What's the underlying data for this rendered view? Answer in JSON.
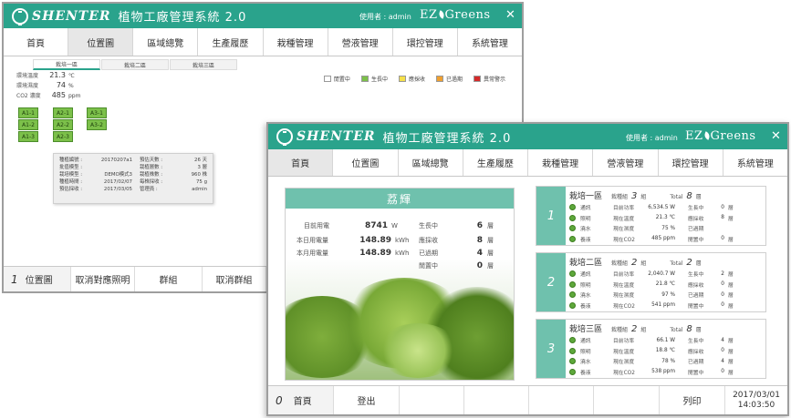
{
  "w1": {
    "brand": "SHENTER",
    "app_title": "植物工廠管理系統 2.0",
    "user": "使用者 : admin",
    "ez_left": "EZ",
    "ez_right": "Greens",
    "nav": [
      "首頁",
      "位置圖",
      "區域總覽",
      "生產履歷",
      "栽種管理",
      "營液管理",
      "環控管理",
      "系統管理"
    ],
    "subtabs": [
      "栽培一區",
      "栽培二區",
      "栽培三區"
    ],
    "env": [
      {
        "label": "環境溫度",
        "value": "21.3",
        "unit": "℃"
      },
      {
        "label": "環境濕度",
        "value": "74",
        "unit": "%"
      },
      {
        "label": "CO2 濃度",
        "value": "485",
        "unit": "ppm"
      }
    ],
    "legend": [
      {
        "label": "閒置中",
        "color": "#ffffff"
      },
      {
        "label": "生長中",
        "color": "#7cc04a"
      },
      {
        "label": "應採收",
        "color": "#f5e04a"
      },
      {
        "label": "已過期",
        "color": "#f0a030"
      },
      {
        "label": "異常警示",
        "color": "#d42a2a"
      }
    ],
    "plots": [
      "A1-1",
      "A1-2",
      "A1-3",
      "A2-1",
      "A2-2",
      "A2-3",
      "A3-1",
      "A3-2"
    ],
    "info_left": [
      {
        "k": "種植編號 :",
        "v": "20170207a1"
      },
      {
        "k": "批值模型 :",
        "v": ""
      },
      {
        "k": "栽培模型 :",
        "v": "DEMO模式3"
      },
      {
        "k": "種植時間 :",
        "v": "2017/02/07"
      },
      {
        "k": "預估採收 :",
        "v": "2017/03/05"
      }
    ],
    "info_right": [
      {
        "k": "預估天數 :",
        "v": "26 天"
      },
      {
        "k": "栽植層數 :",
        "v": "3 層"
      },
      {
        "k": "栽植株數 :",
        "v": "960 株"
      },
      {
        "k": "每株採收 :",
        "v": "75 g"
      },
      {
        "k": "管理員 :",
        "v": "admin"
      }
    ],
    "footer": {
      "num": "1",
      "items": [
        "位置圖",
        "取消對應照明",
        "群組",
        "取消群組"
      ]
    }
  },
  "w2": {
    "brand": "SHENTER",
    "app_title": "植物工廠管理系統 2.0",
    "user": "使用者 : admin",
    "ez_left": "EZ",
    "ez_right": "Greens",
    "nav": [
      "首頁",
      "位置圖",
      "區域總覽",
      "生產履歷",
      "栽種管理",
      "營液管理",
      "環控管理",
      "系統管理"
    ],
    "energy": {
      "title": "荔輝",
      "rows": [
        {
          "label": "目前用電",
          "value": "8741",
          "unit": "W"
        },
        {
          "label": "本日用電量",
          "value": "148.89",
          "unit": "kWh"
        },
        {
          "label": "本月用電量",
          "value": "148.89",
          "unit": "kWh"
        }
      ],
      "status": [
        {
          "label": "生長中",
          "value": "6",
          "unit": "層"
        },
        {
          "label": "應採收",
          "value": "8",
          "unit": "層"
        },
        {
          "label": "已過期",
          "value": "4",
          "unit": "層"
        },
        {
          "label": "閒置中",
          "value": "0",
          "unit": "層"
        }
      ]
    },
    "zones": [
      {
        "num": "1",
        "name": "栽培一區",
        "kind_label": "栽種組",
        "kind": "3",
        "kind_unit": "組",
        "total_label": "Total",
        "total": "8",
        "total_unit": "層",
        "rows": [
          {
            "a": "通訊",
            "b": "目前功率",
            "c": "6,534.5 W",
            "d": "生長中",
            "e": "0",
            "f": "層"
          },
          {
            "a": "照明",
            "b": "現在溫度",
            "c": "21.3 ℃",
            "d": "應採收",
            "e": "8",
            "f": "層"
          },
          {
            "a": "澆水",
            "b": "現在濕度",
            "c": "75 %",
            "d": "已過期",
            "e": "",
            "f": ""
          },
          {
            "a": "養液",
            "b": "現在CO2",
            "c": "485 ppm",
            "d": "閒置中",
            "e": "0",
            "f": "層"
          }
        ]
      },
      {
        "num": "2",
        "name": "栽培二區",
        "kind_label": "栽種組",
        "kind": "2",
        "kind_unit": "組",
        "total_label": "Total",
        "total": "2",
        "total_unit": "層",
        "rows": [
          {
            "a": "通訊",
            "b": "目前功率",
            "c": "2,040.7 W",
            "d": "生長中",
            "e": "2",
            "f": "層"
          },
          {
            "a": "照明",
            "b": "現在溫度",
            "c": "21.8 ℃",
            "d": "應採收",
            "e": "0",
            "f": "層"
          },
          {
            "a": "澆水",
            "b": "現在濕度",
            "c": "97 %",
            "d": "已過期",
            "e": "0",
            "f": "層"
          },
          {
            "a": "養液",
            "b": "現在CO2",
            "c": "541 ppm",
            "d": "閒置中",
            "e": "0",
            "f": "層"
          }
        ]
      },
      {
        "num": "3",
        "name": "栽培三區",
        "kind_label": "栽種組",
        "kind": "2",
        "kind_unit": "組",
        "total_label": "Total",
        "total": "8",
        "total_unit": "層",
        "rows": [
          {
            "a": "通訊",
            "b": "目前功率",
            "c": "66.1 W",
            "d": "生長中",
            "e": "4",
            "f": "層"
          },
          {
            "a": "照明",
            "b": "現在溫度",
            "c": "18.8 ℃",
            "d": "應採收",
            "e": "0",
            "f": "層"
          },
          {
            "a": "澆水",
            "b": "現在濕度",
            "c": "78 %",
            "d": "已過期",
            "e": "4",
            "f": "層"
          },
          {
            "a": "養液",
            "b": "現在CO2",
            "c": "538 ppm",
            "d": "閒置中",
            "e": "0",
            "f": "層"
          }
        ]
      }
    ],
    "footer": {
      "num": "0",
      "home": "首頁",
      "logout": "登出",
      "print": "列印",
      "date": "2017/03/01",
      "time": "14:03:50"
    }
  },
  "colors": {
    "accent": "#2aa38c",
    "card_head": "#6fc1ad",
    "growing": "#7cc04a"
  }
}
